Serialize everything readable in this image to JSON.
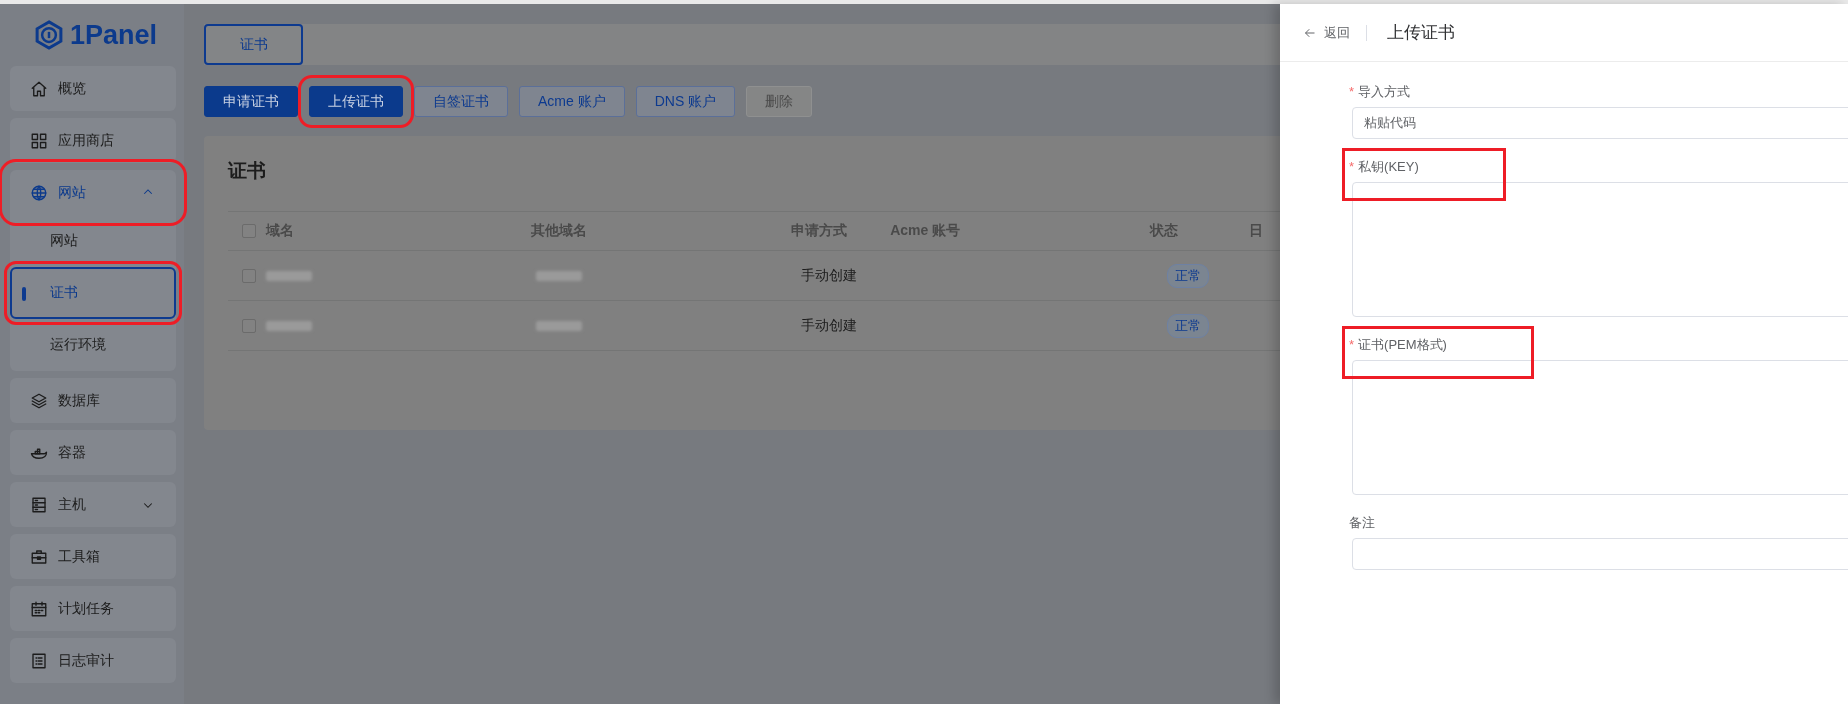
{
  "sidebar": {
    "logo": "1Panel",
    "items": [
      {
        "label": "概览",
        "selected": false
      },
      {
        "label": "应用商店",
        "selected": false
      },
      {
        "label": "网站",
        "selected": true,
        "expanded": true,
        "highlighted": true,
        "children": [
          {
            "label": "网站",
            "selected": false,
            "highlighted": false
          },
          {
            "label": "证书",
            "selected": true,
            "highlighted": true
          },
          {
            "label": "运行环境",
            "selected": false,
            "highlighted": false
          }
        ]
      },
      {
        "label": "数据库",
        "selected": false
      },
      {
        "label": "容器",
        "selected": false
      },
      {
        "label": "主机",
        "selected": false,
        "expanded": false
      },
      {
        "label": "工具箱",
        "selected": false
      },
      {
        "label": "计划任务",
        "selected": false
      },
      {
        "label": "日志审计",
        "selected": false
      }
    ]
  },
  "tabs": [
    {
      "label": "证书",
      "selected": true
    }
  ],
  "toolbar": [
    {
      "label": "申请证书",
      "kind": "primary",
      "disabled": false,
      "highlighted": false
    },
    {
      "label": "上传证书",
      "kind": "primary",
      "disabled": false,
      "highlighted": true
    },
    {
      "label": "自签证书",
      "kind": "outline",
      "disabled": false,
      "highlighted": false
    },
    {
      "label": "Acme 账户",
      "kind": "outline",
      "disabled": false,
      "highlighted": false
    },
    {
      "label": "DNS 账户",
      "kind": "outline",
      "disabled": false,
      "highlighted": false
    },
    {
      "label": "删除",
      "kind": "outline",
      "disabled": true,
      "highlighted": false
    }
  ],
  "card": {
    "title": "证书",
    "table": {
      "all_checked": false,
      "columns": [
        "域名",
        "其他域名",
        "申请方式",
        "Acme 账号",
        "状态",
        "日"
      ],
      "rows": [
        {
          "checked": false,
          "cells": [
            {
              "kind": "redacted"
            },
            {
              "kind": "redacted"
            },
            {
              "kind": "text",
              "text": "手动创建"
            },
            {
              "kind": "blank"
            },
            {
              "kind": "tag",
              "text": "正常"
            }
          ]
        },
        {
          "checked": false,
          "cells": [
            {
              "kind": "redacted"
            },
            {
              "kind": "redacted"
            },
            {
              "kind": "text",
              "text": "手动创建"
            },
            {
              "kind": "blank"
            },
            {
              "kind": "tag",
              "text": "正常"
            }
          ]
        }
      ]
    }
  },
  "drawer": {
    "back": "返回",
    "title": "上传证书",
    "required_mark": "*",
    "fields": [
      {
        "label": "导入方式",
        "required": true,
        "kind": "select",
        "value": "粘贴代码",
        "highlighted": false
      },
      {
        "label": "私钥(KEY)",
        "required": true,
        "kind": "textarea",
        "highlighted": true
      },
      {
        "label": "证书(PEM格式)",
        "required": true,
        "kind": "textarea",
        "highlighted": true
      },
      {
        "label": "备注",
        "required": false,
        "kind": "input",
        "highlighted": false
      }
    ]
  }
}
